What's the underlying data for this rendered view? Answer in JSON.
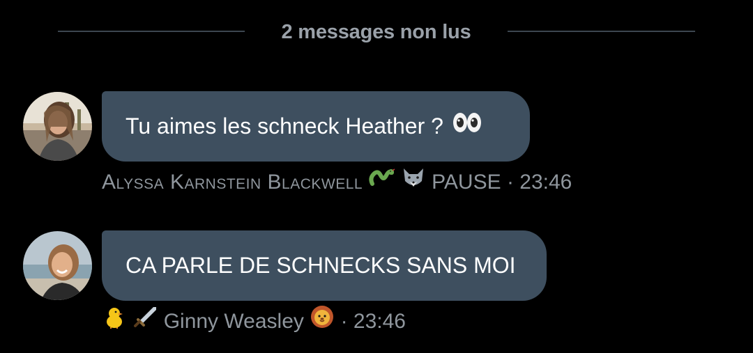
{
  "unread_divider": {
    "label": "2 messages non lus"
  },
  "messages": [
    {
      "text": "Tu aimes les schneck Heather ?",
      "emoji": "eyes-emoji",
      "author_prefix_icons": [],
      "author": "Alyssa Karnstein Blackwell",
      "author_suffix_icons": [
        "snake-emoji",
        "wolf-emoji"
      ],
      "status": "PAUSE",
      "separator": "·",
      "time": "23:46"
    },
    {
      "text": "CA PARLE DE SCHNECKS SANS MOI",
      "author_prefix_icons": [
        "chick-emoji",
        "sword-emoji"
      ],
      "author": "Ginny Weasley",
      "author_suffix_icons": [
        "lion-emoji"
      ],
      "separator": "·",
      "time": "23:46"
    }
  ],
  "colors": {
    "background": "#000000",
    "bubble": "#3e4f5f",
    "bubble_text": "#ffffff",
    "meta_text": "#8f969d",
    "divider": "#3d4650"
  }
}
